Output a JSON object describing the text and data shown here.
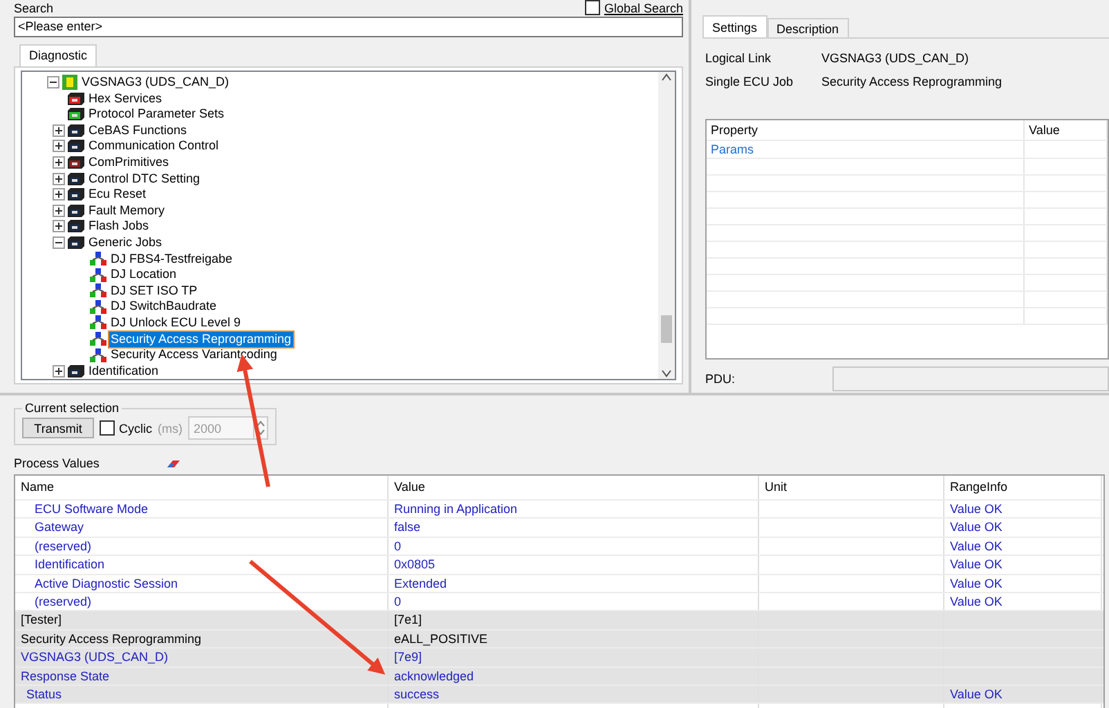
{
  "search": {
    "label": "Search",
    "placeholder": "<Please enter>",
    "global_search": {
      "label": "Global Search",
      "checked": false
    }
  },
  "left_tabs": [
    {
      "label": "Diagnostic",
      "selected": true
    }
  ],
  "tree": [
    {
      "label": "VGSNAG3 (UDS_CAN_D)",
      "kind": "ecu",
      "expanded": true,
      "selected": false,
      "children": [
        {
          "label": "Hex Services",
          "kind": "service_red",
          "selected": false
        },
        {
          "label": "Protocol Parameter Sets",
          "kind": "service_green",
          "selected": false
        },
        {
          "label": "CeBAS Functions",
          "kind": "folder",
          "expanded": false,
          "selected": false
        },
        {
          "label": "Communication Control",
          "kind": "folder",
          "expanded": false,
          "selected": false
        },
        {
          "label": "ComPrimitives",
          "kind": "folder_red",
          "expanded": false,
          "selected": false
        },
        {
          "label": "Control DTC Setting",
          "kind": "folder",
          "expanded": false,
          "selected": false
        },
        {
          "label": "Ecu Reset",
          "kind": "folder",
          "expanded": false,
          "selected": false
        },
        {
          "label": "Fault Memory",
          "kind": "folder",
          "expanded": false,
          "selected": false
        },
        {
          "label": "Flash Jobs",
          "kind": "folder",
          "expanded": false,
          "selected": false
        },
        {
          "label": "Generic Jobs",
          "kind": "folder",
          "expanded": true,
          "selected": false,
          "children": [
            {
              "label": "DJ FBS4-Testfreigabe",
              "kind": "job",
              "selected": false
            },
            {
              "label": "DJ Location",
              "kind": "job",
              "selected": false
            },
            {
              "label": "DJ SET ISO TP",
              "kind": "job",
              "selected": false
            },
            {
              "label": "DJ SwitchBaudrate",
              "kind": "job",
              "selected": false
            },
            {
              "label": "DJ Unlock ECU Level 9",
              "kind": "job",
              "selected": false
            },
            {
              "label": "Security Access Reprogramming",
              "kind": "job",
              "selected": true
            },
            {
              "label": "Security Access Variantcoding",
              "kind": "job",
              "selected": false
            }
          ]
        },
        {
          "label": "Identification",
          "kind": "folder",
          "expanded": false,
          "selected": false
        }
      ]
    }
  ],
  "right_tabs": [
    {
      "label": "Settings",
      "selected": true
    },
    {
      "label": "Description",
      "selected": false
    }
  ],
  "settings": [
    {
      "label": "Logical Link",
      "value": "VGSNAG3 (UDS_CAN_D)"
    },
    {
      "label": "Single ECU Job",
      "value": "Security Access Reprogramming"
    }
  ],
  "property_table": {
    "columns": [
      "Property",
      "Value"
    ],
    "rows": [
      {
        "property": "Params"
      }
    ]
  },
  "pdu": {
    "label": "PDU:"
  },
  "current_selection": {
    "title": "Current selection",
    "transmit": "Transmit",
    "cyclic": {
      "label": "Cyclic",
      "checked": false
    },
    "unit": "(ms)",
    "interval": "2000"
  },
  "process_values": {
    "title": "Process Values",
    "columns": [
      "Name",
      "Value",
      "Unit",
      "RangeInfo"
    ],
    "rows": [
      {
        "kind": "param",
        "name": "ECU Software Mode",
        "value": "Running in Application",
        "range": "Value OK"
      },
      {
        "kind": "param",
        "name": "Gateway",
        "value": "false",
        "range": "Value OK"
      },
      {
        "kind": "param",
        "name": "(reserved)",
        "value": "0",
        "range": "Value OK"
      },
      {
        "kind": "param",
        "name": "Identification",
        "value": "0x0805",
        "range": "Value OK"
      },
      {
        "kind": "param",
        "name": "Active Diagnostic Session",
        "value": "Extended",
        "range": "Value OK"
      },
      {
        "kind": "param",
        "name": "(reserved)",
        "value": "0",
        "range": "Value OK"
      },
      {
        "kind": "group",
        "name": "[Tester]",
        "value": "[7e1]"
      },
      {
        "kind": "group",
        "name": "Security Access Reprogramming",
        "value": "eALL_POSITIVE"
      },
      {
        "kind": "link",
        "name": "VGSNAG3 (UDS_CAN_D)",
        "value": "[7e9]"
      },
      {
        "kind": "link",
        "name": "Response State",
        "value": "acknowledged"
      },
      {
        "kind": "sub",
        "name": "Status",
        "value": "success",
        "range": "Value OK"
      }
    ]
  }
}
